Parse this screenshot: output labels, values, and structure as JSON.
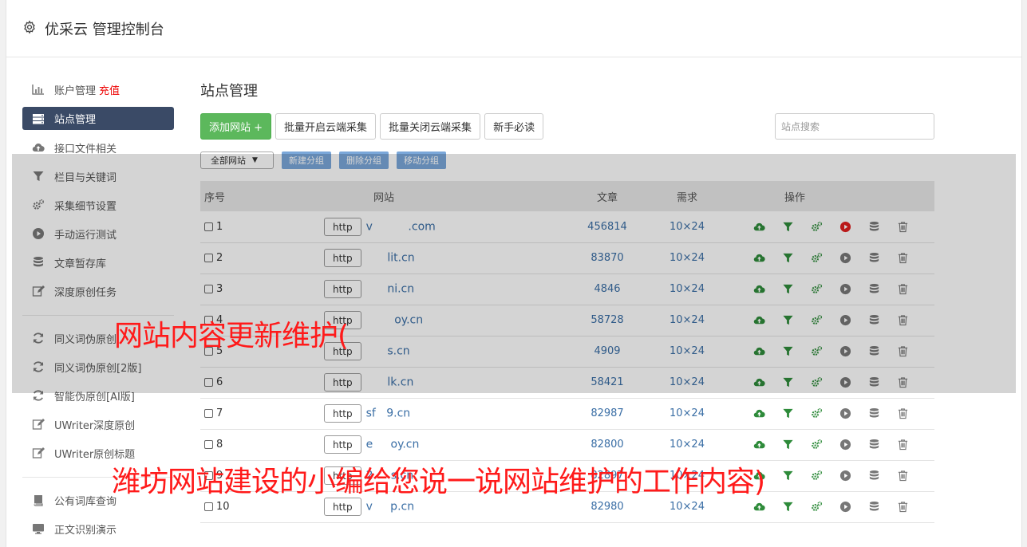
{
  "header": {
    "title": "优采云 管理控制台",
    "icon": "gear-icon"
  },
  "sidebar": {
    "items": [
      {
        "label": "账户管理",
        "badge": "充值",
        "icon": "bar-chart-icon"
      },
      {
        "label": "站点管理",
        "icon": "server-icon",
        "active": true
      },
      {
        "label": "接口文件相关",
        "icon": "cloud-upload-icon"
      },
      {
        "label": "栏目与关键词",
        "icon": "filter-icon"
      },
      {
        "label": "采集细节设置",
        "icon": "cogs-icon"
      },
      {
        "label": "手动运行测试",
        "icon": "play-circle-icon"
      },
      {
        "label": "文章暂存库",
        "icon": "database-icon"
      },
      {
        "label": "深度原创任务",
        "icon": "edit-icon"
      }
    ],
    "items2": [
      {
        "label": "同义词伪原创",
        "icon": "refresh-icon"
      },
      {
        "label": "同义词伪原创[2版]",
        "icon": "refresh-icon"
      },
      {
        "label": "智能伪原创[AI版]",
        "icon": "refresh-icon"
      },
      {
        "label": "UWriter深度原创",
        "icon": "edit-icon"
      },
      {
        "label": "UWriter原创标题",
        "icon": "edit-icon"
      }
    ],
    "items3": [
      {
        "label": "公有词库查询",
        "icon": "book-icon"
      },
      {
        "label": "正文识别演示",
        "icon": "monitor-icon"
      }
    ]
  },
  "main": {
    "title": "站点管理",
    "toolbar": {
      "add": "添加网站 +",
      "batch_on": "批量开启云端采集",
      "batch_off": "批量关闭云端采集",
      "guide": "新手必读",
      "search_placeholder": "站点搜索"
    },
    "subbar": {
      "group_select": "全部网站",
      "new_group": "新建分组",
      "delete_group": "删除分组",
      "move_group": "移动分组"
    },
    "table": {
      "headers": {
        "no": "序号",
        "site": "网站",
        "articles": "文章",
        "demand": "需求",
        "ops": "操作"
      },
      "rows": [
        {
          "no": "1",
          "protocol": "http",
          "domain": "v          .com",
          "articles": "456814",
          "demand": "10×24",
          "running": true
        },
        {
          "no": "2",
          "protocol": "http",
          "domain": "      lit.cn",
          "articles": "83870",
          "demand": "10×24",
          "running": false
        },
        {
          "no": "3",
          "protocol": "http",
          "domain": "      ni.cn",
          "articles": "4846",
          "demand": "10×24",
          "running": false
        },
        {
          "no": "4",
          "protocol": "http",
          "domain": "        oy.cn",
          "articles": "58728",
          "demand": "10×24",
          "running": false
        },
        {
          "no": "5",
          "protocol": "http",
          "domain": "      s.cn",
          "articles": "4909",
          "demand": "10×24",
          "running": false
        },
        {
          "no": "6",
          "protocol": "http",
          "domain": "      lk.cn",
          "articles": "58421",
          "demand": "10×24",
          "running": false
        },
        {
          "no": "7",
          "protocol": "http",
          "domain": "sf   9.cn",
          "articles": "82987",
          "demand": "10×24",
          "running": false
        },
        {
          "no": "8",
          "protocol": "http",
          "domain": "e     oy.cn",
          "articles": "82800",
          "demand": "10×24",
          "running": false
        },
        {
          "no": "9",
          "protocol": "http",
          "domain": "2     s.cn",
          "articles": "82897",
          "demand": "10×24",
          "running": false
        },
        {
          "no": "10",
          "protocol": "http",
          "domain": "v     p.cn",
          "articles": "82980",
          "demand": "10×24",
          "running": false
        }
      ]
    }
  },
  "watermark": {
    "line1": "网站内容更新维护(",
    "line2": "潍坊网站建设的小编给您说一说网站维护的工作内容)"
  },
  "colors": {
    "accent_green": "#5cb85c",
    "nav_active": "#3a4a66",
    "link_blue": "#3a6ea5",
    "run_red": "#e02020",
    "watermark_red": "#ff1a1a"
  }
}
